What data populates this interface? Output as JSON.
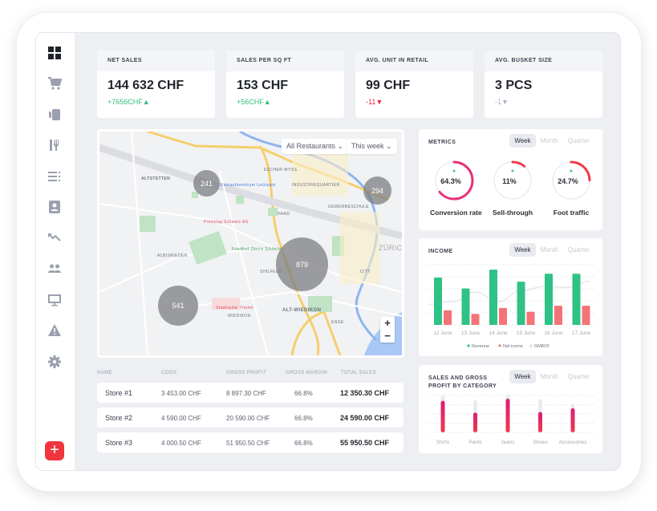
{
  "sidebar": {
    "items": [
      {
        "icon": "dashboard-icon",
        "active": true
      },
      {
        "icon": "cart-icon"
      },
      {
        "icon": "pos-terminal-icon"
      },
      {
        "icon": "restaurant-icon"
      },
      {
        "icon": "list-icon"
      },
      {
        "icon": "contact-icon"
      },
      {
        "icon": "trend-icon"
      },
      {
        "icon": "people-icon"
      },
      {
        "icon": "monitor-icon"
      },
      {
        "icon": "warning-icon"
      },
      {
        "icon": "settings-icon"
      }
    ],
    "add_label": "+"
  },
  "kpis": [
    {
      "title": "NET SALES",
      "value": "144 632 CHF",
      "delta": "+7656CHF▲",
      "color": "#2fbf7c"
    },
    {
      "title": "SALES PER SQ FT",
      "value": "153 CHF",
      "delta": "+56CHF▲",
      "color": "#2fbf7c"
    },
    {
      "title": "AVG. UNIT IN RETAIL",
      "value": "99 CHF",
      "delta": "-11▼",
      "color": "#ee2b36"
    },
    {
      "title": "AVG. BUSKET SIZE",
      "value": "3 PCS",
      "delta": "-1▼",
      "color": "#aeb3c2"
    }
  ],
  "map": {
    "filter_restaurants": "All Restaurants ⌄",
    "filter_period": "This week ⌄",
    "clusters": [
      "241",
      "294",
      "879",
      "541"
    ],
    "labels": [
      "ALTSTETTEN",
      "ALBISRIEDEN",
      "ALT-WIEDIKON",
      "ZÜRICH",
      "ENGE",
      "CITY",
      "WIEDIKON",
      "HARD",
      "SIHLFELD",
      "ESCHER WYSS",
      "INDUSTRIEQUARTIER",
      "GEWERBESCHULE",
      "Primetag Schweiz AG",
      "Stadtspital Triemli",
      "Friedhof Zürich Sihlfeld",
      "Einkaufszentrum Letzipark"
    ],
    "zoom_in": "+",
    "zoom_out": "−"
  },
  "metrics": {
    "title": "METRICS",
    "tabs": [
      "Week",
      "Month",
      "Quarter"
    ],
    "gauges": [
      {
        "label": "Conversion rate",
        "value": "64.3%",
        "pct": 64.3
      },
      {
        "label": "Sell-through",
        "value": "11%",
        "pct": 11
      },
      {
        "label": "Foot traffic",
        "value": "24.7%",
        "pct": 24.7
      }
    ]
  },
  "income": {
    "title": "INCOME",
    "tabs": [
      "Week",
      "Month",
      "Quarter"
    ],
    "chart_data": {
      "type": "bar",
      "categories": [
        "12 June",
        "13 June",
        "14 June",
        "15 June",
        "16 June",
        "17 June"
      ],
      "series": [
        {
          "name": "Revenue",
          "values": [
            173,
            133,
            202,
            158,
            187,
            187
          ],
          "color": "#2fc285"
        },
        {
          "name": "Net icome",
          "values": [
            53,
            40,
            62,
            48,
            70,
            70
          ],
          "color": "#f47378"
        },
        {
          "name": "GMROI",
          "type": "line",
          "values": [
            75,
            85,
            120,
            85,
            125,
            140,
            137,
            160
          ],
          "color": "#dfe1e7"
        }
      ],
      "ylim": [
        0,
        220
      ],
      "grid": true,
      "legend": "bottom"
    }
  },
  "category": {
    "title_line1": "SALES AND GROSS",
    "title_line2": "PROFIT BY CATEGORY",
    "tabs": [
      "Week",
      "Month",
      "Quarter"
    ],
    "chart_data": {
      "type": "bar",
      "categories": [
        "Shirts",
        "Pants",
        "Jeans",
        "Shoes",
        "Accessories"
      ],
      "series": [
        {
          "values": [
            118,
            74,
            126,
            76,
            90
          ]
        },
        {
          "values": [
            138,
            120,
            142,
            124,
            105
          ]
        }
      ],
      "ylim": [
        0,
        150
      ],
      "grid": true
    }
  },
  "table": {
    "headers": [
      "NAME",
      "COGS",
      "GROSS PROFIT",
      "GROSS MARGIN",
      "TOTAL SALES"
    ],
    "rows": [
      [
        "Store #1",
        "3 453.00 CHF",
        "8 897.30 CHF",
        "66.8%",
        "12 350.30 CHF"
      ],
      [
        "Store #2",
        "4 590.00 CHF",
        "20 590.00 CHF",
        "66.8%",
        "24 590.00 CHF"
      ],
      [
        "Store #3",
        "4 000.50 CHF",
        "51 950.50 CHF",
        "66.8%",
        "55 950.50 CHF"
      ]
    ]
  }
}
